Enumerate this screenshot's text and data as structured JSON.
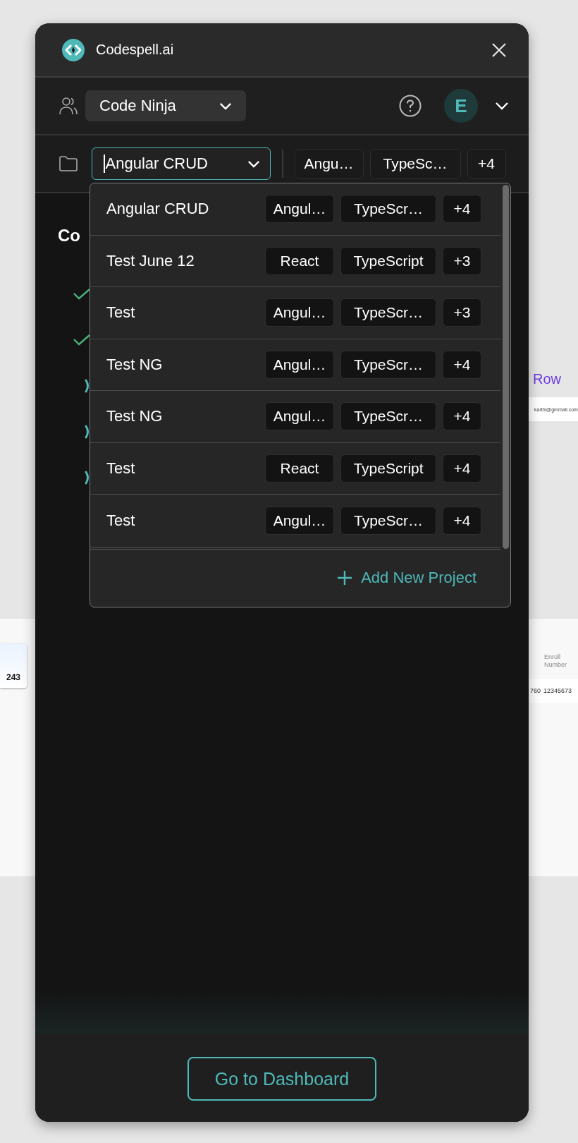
{
  "backdrop": {
    "link": "Row",
    "email": "karthi@gmmail.com",
    "stat": "243",
    "column_header": "Enroll Number",
    "cells": [
      "760",
      "12345673"
    ]
  },
  "app": {
    "title": "Codespell.ai"
  },
  "workspace": {
    "value": "Code Ninja"
  },
  "account": {
    "initial": "E"
  },
  "project_select": {
    "value": "Angular CRUD",
    "tags": [
      "Angu…",
      "TypeSc…",
      "+4"
    ]
  },
  "progress": {
    "heading": "Co",
    "steps": [
      {
        "kind": "done"
      },
      {
        "kind": "done"
      },
      {
        "kind": "loading"
      },
      {
        "kind": "loading"
      },
      {
        "kind": "loading"
      }
    ]
  },
  "projects": [
    {
      "name": "Angular CRUD",
      "tags": [
        "Angul…",
        "TypeScr…",
        "+4"
      ]
    },
    {
      "name": "Test June 12",
      "tags": [
        "React",
        "TypeScript",
        "+3"
      ]
    },
    {
      "name": "Test",
      "tags": [
        "Angul…",
        "TypeScr…",
        "+3"
      ]
    },
    {
      "name": "Test NG",
      "tags": [
        "Angul…",
        "TypeScr…",
        "+4"
      ]
    },
    {
      "name": "Test NG",
      "tags": [
        "Angul…",
        "TypeScr…",
        "+4"
      ]
    },
    {
      "name": "Test",
      "tags": [
        "React",
        "TypeScript",
        "+4"
      ]
    },
    {
      "name": "Test",
      "tags": [
        "Angul…",
        "TypeScr…",
        "+4"
      ]
    }
  ],
  "add_project": {
    "label": "Add New Project"
  },
  "dashboard_button": {
    "label": "Go to Dashboard"
  }
}
